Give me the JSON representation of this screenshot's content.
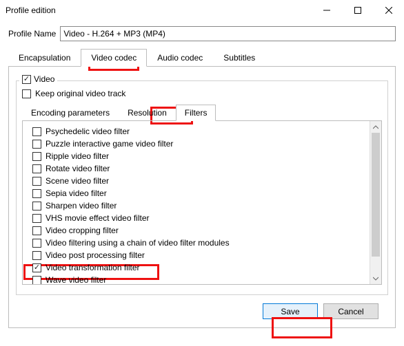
{
  "window": {
    "title": "Profile edition"
  },
  "profile": {
    "name_label": "Profile Name",
    "name_value": "Video - H.264 + MP3 (MP4)"
  },
  "tabs": {
    "encapsulation": "Encapsulation",
    "video_codec": "Video codec",
    "audio_codec": "Audio codec",
    "subtitles": "Subtitles"
  },
  "video_group": {
    "legend": "Video",
    "keep_original": "Keep original video track"
  },
  "subtabs": {
    "encoding_params": "Encoding parameters",
    "resolution": "Resolution",
    "filters": "Filters"
  },
  "filters": [
    {
      "label": "Psychedelic video filter",
      "checked": false
    },
    {
      "label": "Puzzle interactive game video filter",
      "checked": false
    },
    {
      "label": "Ripple video filter",
      "checked": false
    },
    {
      "label": "Rotate video filter",
      "checked": false
    },
    {
      "label": "Scene video filter",
      "checked": false
    },
    {
      "label": "Sepia video filter",
      "checked": false
    },
    {
      "label": "Sharpen video filter",
      "checked": false
    },
    {
      "label": "VHS movie effect video filter",
      "checked": false
    },
    {
      "label": "Video cropping filter",
      "checked": false
    },
    {
      "label": "Video filtering using a chain of video filter modules",
      "checked": false
    },
    {
      "label": "Video post processing filter",
      "checked": false
    },
    {
      "label": "Video transformation filter",
      "checked": true
    },
    {
      "label": "Wave video filter",
      "checked": false
    }
  ],
  "buttons": {
    "save": "Save",
    "cancel": "Cancel"
  }
}
